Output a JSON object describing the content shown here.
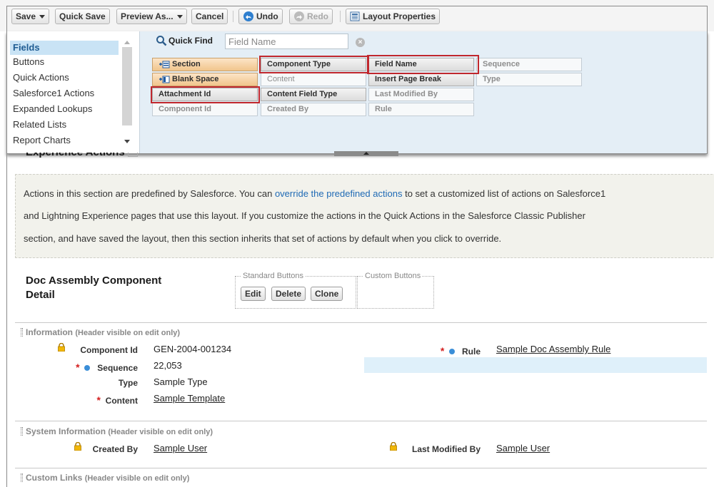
{
  "toolbar": {
    "save": "Save",
    "quick_save": "Quick Save",
    "preview_as": "Preview As...",
    "cancel": "Cancel",
    "undo": "Undo",
    "redo": "Redo",
    "layout_properties": "Layout Properties"
  },
  "palette": {
    "categories": [
      "Fields",
      "Buttons",
      "Quick Actions",
      "Salesforce1 Actions",
      "Expanded Lookups",
      "Related Lists",
      "Report Charts"
    ],
    "selected_category": "Fields",
    "quick_find_label": "Quick Find",
    "quick_find_placeholder": "Field Name",
    "fields": {
      "section": "Section",
      "blank_space": "Blank Space",
      "attachment_id": "Attachment Id",
      "component_id": "Component Id",
      "component_type": "Component Type",
      "content": "Content",
      "content_field_type": "Content Field Type",
      "created_by": "Created By",
      "field_name": "Field Name",
      "insert_page_break": "Insert Page Break",
      "last_modified_by": "Last Modified By",
      "rule": "Rule",
      "sequence": "Sequence",
      "type": "Type"
    },
    "highlight_color": "#c0272d"
  },
  "experience_actions": {
    "title": "Experience Actions",
    "line1_pre": "Actions in this section are predefined by Salesforce. You can ",
    "line1_link": "override the predefined actions",
    "line1_post": " to set a customized list of actions on Salesforce1",
    "line2": "and Lightning Experience pages that use this layout. If you customize the actions in the Quick Actions in the Salesforce Classic Publisher",
    "line3": "section, and have saved the layout, then this section inherits that set of actions by default when you click to override."
  },
  "detail": {
    "title_line1": "Doc Assembly Component",
    "title_line2": "Detail",
    "standard_buttons_legend": "Standard Buttons",
    "custom_buttons_legend": "Custom Buttons",
    "edit": "Edit",
    "delete": "Delete",
    "clone": "Clone"
  },
  "sections": {
    "information": {
      "name": "Information",
      "note": "(Header visible on edit only)"
    },
    "system_information": {
      "name": "System Information",
      "note": "(Header visible on edit only)"
    },
    "custom_links": {
      "name": "Custom Links",
      "note": "(Header visible on edit only)"
    }
  },
  "record": {
    "component_id_label": "Component Id",
    "component_id_value": "GEN-2004-001234",
    "sequence_label": "Sequence",
    "sequence_value": "22,053",
    "type_label": "Type",
    "type_value": "Sample Type",
    "content_label": "Content",
    "content_value": "Sample Template",
    "rule_label": "Rule",
    "rule_value": "Sample Doc Assembly Rule",
    "created_by_label": "Created By",
    "created_by_value": "Sample User",
    "last_modified_by_label": "Last Modified By",
    "last_modified_by_value": "Sample User",
    "required_mark": "*"
  },
  "colors": {
    "link": "#1f6ab5",
    "required": "#d41f1f",
    "info_dot": "#3a8ed8",
    "selected_category": "#c9e3f5",
    "palette_bg": "#e4eef6"
  }
}
